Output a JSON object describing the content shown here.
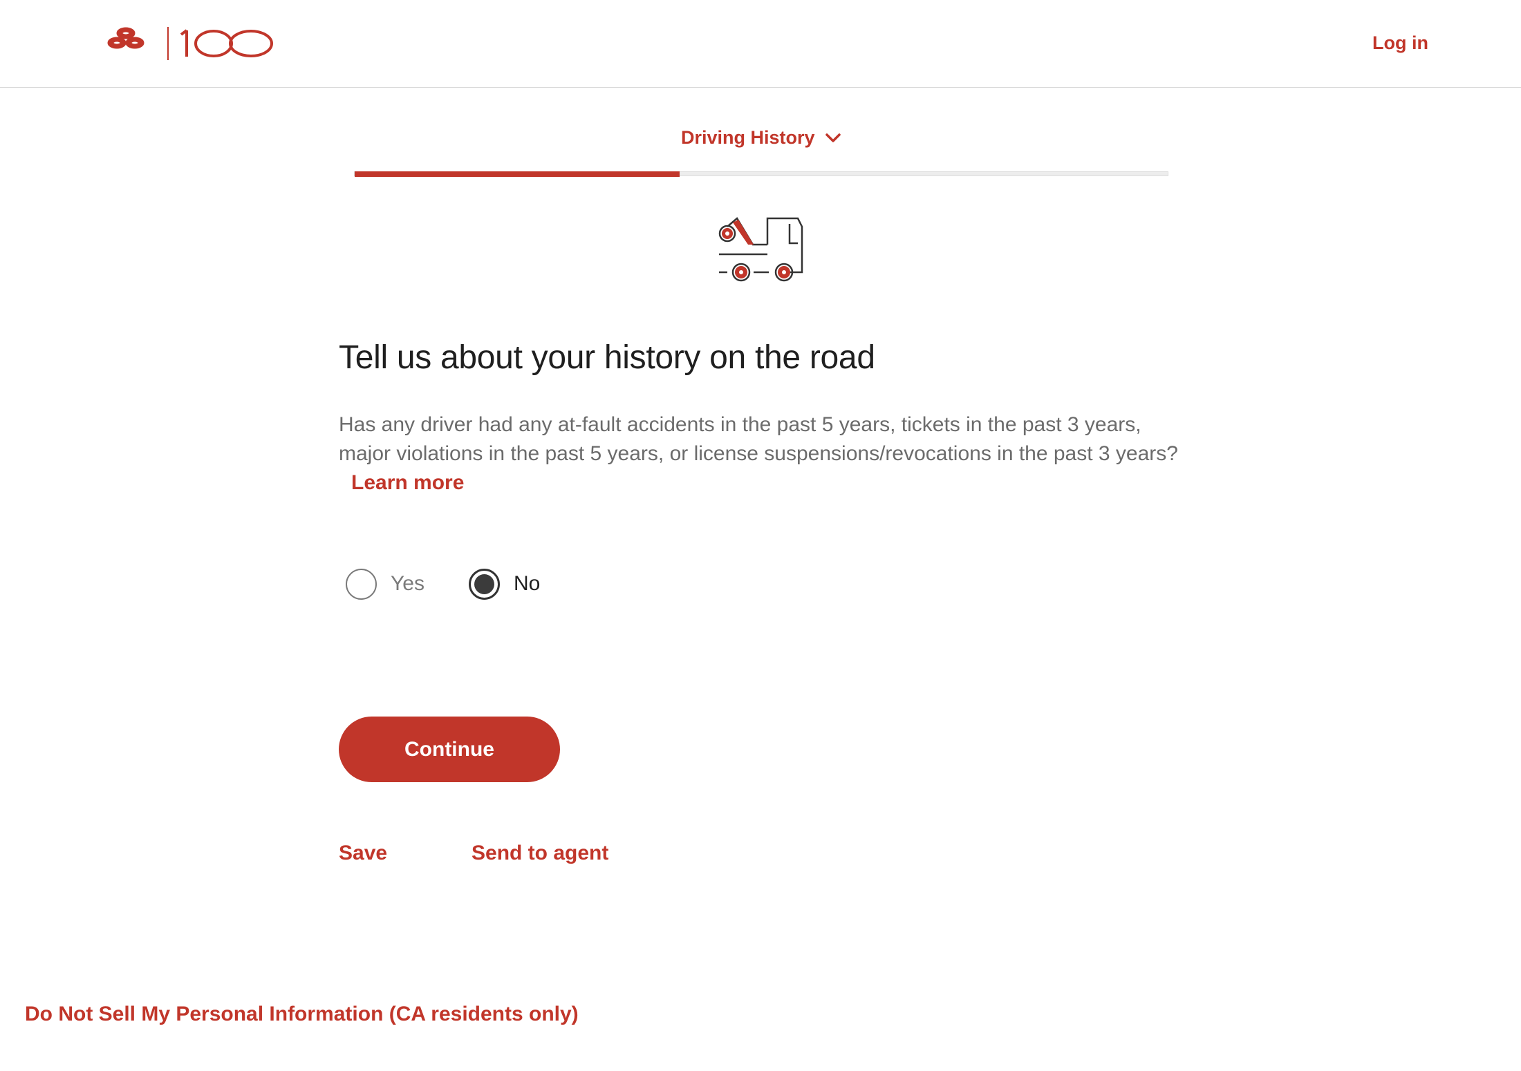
{
  "header": {
    "logo_text": "100",
    "login_label": "Log in"
  },
  "progress": {
    "section_label": "Driving History",
    "fraction_complete": 0.4
  },
  "content": {
    "heading": "Tell us about your history on the road",
    "question": "Has any driver had any at-fault accidents in the past 5 years, tickets in the past 3 years, major violations in the past 5 years, or license suspensions/revocations in the past 3 years?",
    "learn_more": "Learn more"
  },
  "radio": {
    "yes_label": "Yes",
    "no_label": "No",
    "selected": "No"
  },
  "actions": {
    "continue_label": "Continue",
    "save_label": "Save",
    "send_to_agent_label": "Send to agent"
  },
  "footer": {
    "privacy_link": "Do Not Sell My Personal Information (CA residents only)"
  },
  "colors": {
    "brand_red": "#c1362a",
    "text_dark": "#1f1f1f",
    "text_muted": "#6b6b6b"
  }
}
